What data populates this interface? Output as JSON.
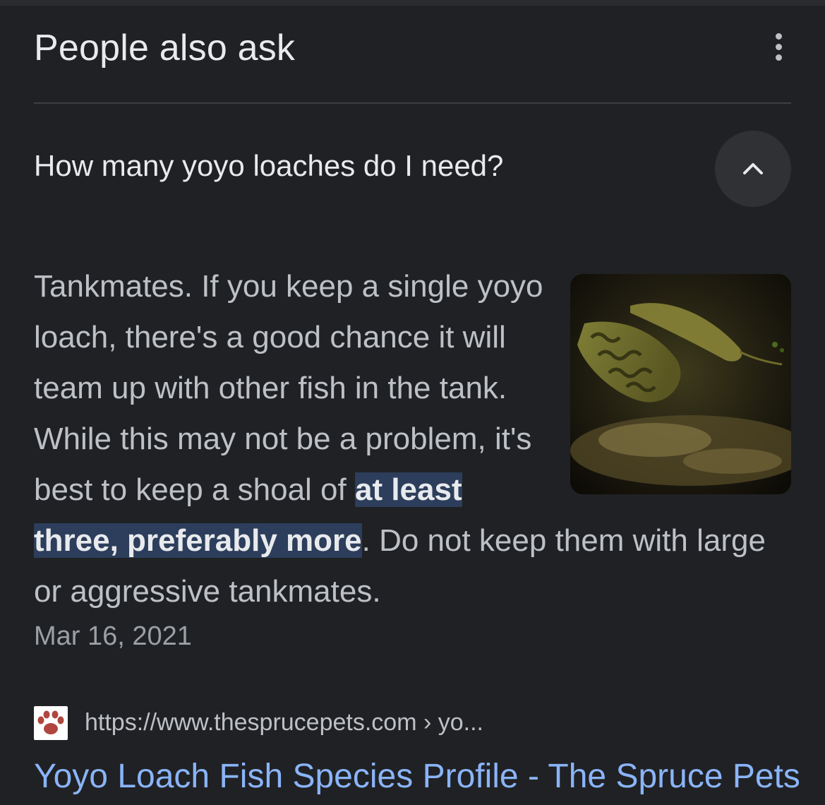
{
  "section": {
    "title": "People also ask"
  },
  "question": {
    "text": "How many yoyo loaches do I need?"
  },
  "answer": {
    "text_before": "Tankmates. If you keep a single yoyo loach, there's a good chance it will team up with other fish in the tank. While this may not be a problem, it's best to keep a shoal of ",
    "highlight": "at least three, preferably more",
    "text_after": ". Do not keep them with large or aggressive tankmates.",
    "date": "Mar 16, 2021"
  },
  "source": {
    "url": "https://www.thesprucepets.com › yo...",
    "favicon_icon": "paw-icon",
    "title": "Yoyo Loach Fish Species Profile - The Spruce Pets"
  },
  "colors": {
    "background": "#202124",
    "highlight": "#2c3e5b",
    "link": "#8ab4f8"
  }
}
